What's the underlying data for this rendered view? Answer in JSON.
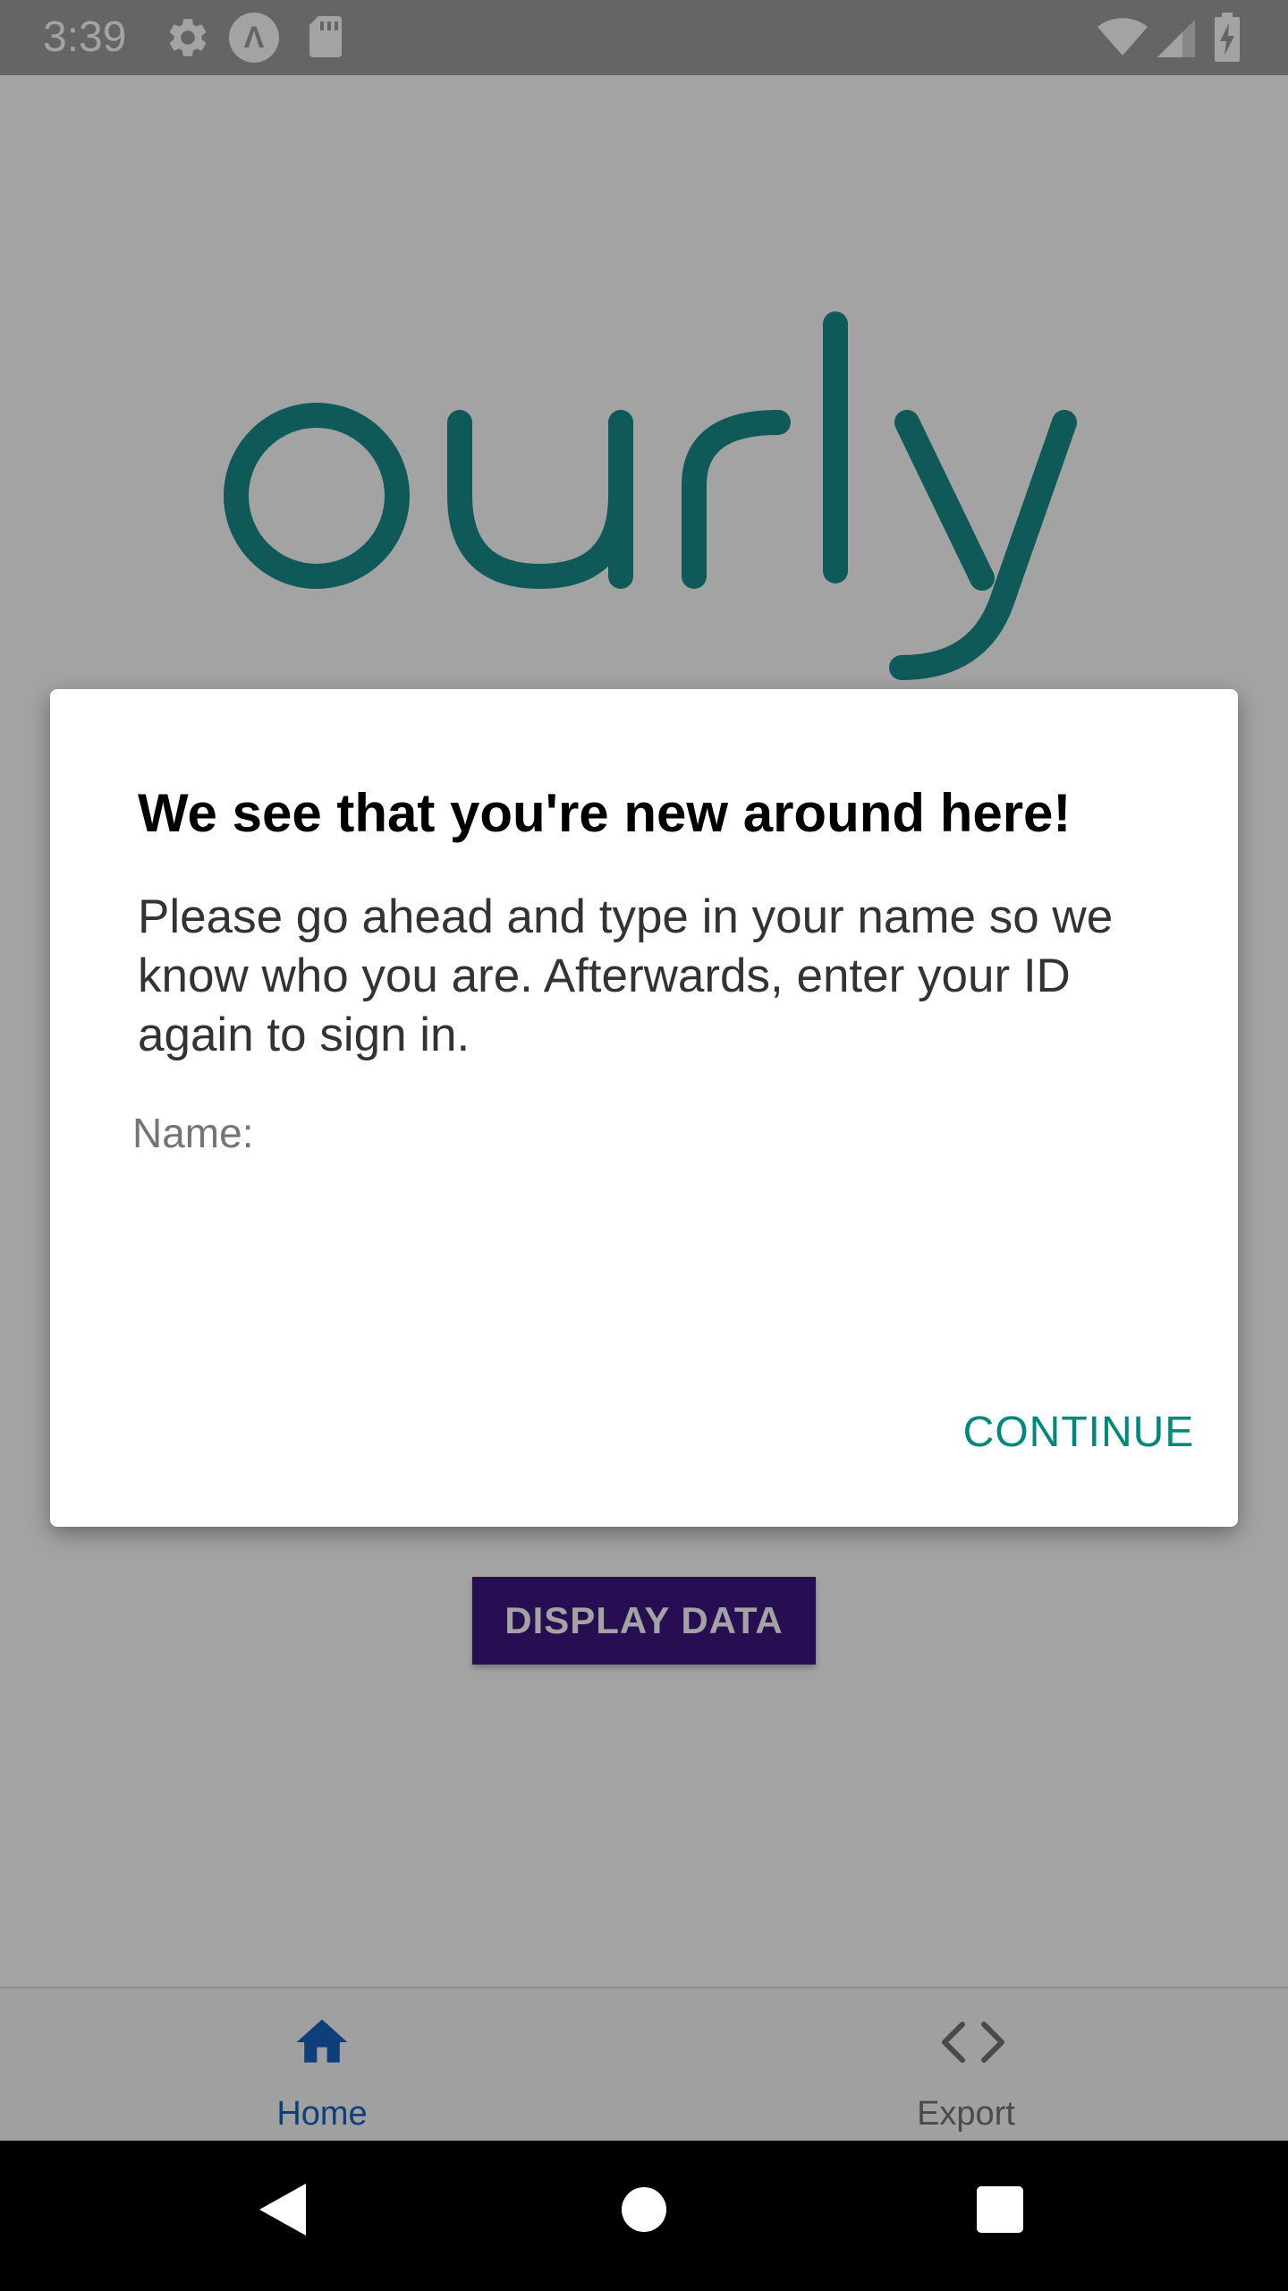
{
  "status_bar": {
    "time": "3:39",
    "icons": [
      "gear-icon",
      "a-icon",
      "sd-card-icon",
      "wifi-icon",
      "signal-icon",
      "battery-charging-icon"
    ],
    "a_glyph": "Λ"
  },
  "app": {
    "logo_text": "ourly",
    "logo_color": "#1a8c8c",
    "display_button_label": "DISPLAY DATA",
    "display_button_color": "#3d1580"
  },
  "dialog": {
    "title": "We see that you're new around here!",
    "message": "Please go ahead and type in your name so we know who you are. Afterwards, enter your ID again to sign in.",
    "name_label": "Name:",
    "name_value": "",
    "continue_label": "CONTINUE",
    "accent_color": "#00897b"
  },
  "bottom_nav": {
    "items": [
      {
        "label": "Home",
        "icon": "home-icon",
        "active": true
      },
      {
        "label": "Export",
        "icon": "code-icon",
        "active": false
      }
    ],
    "active_color": "#1565c0"
  },
  "system_nav": {
    "icons": [
      "back-icon",
      "home-circle-icon",
      "recents-icon"
    ]
  }
}
